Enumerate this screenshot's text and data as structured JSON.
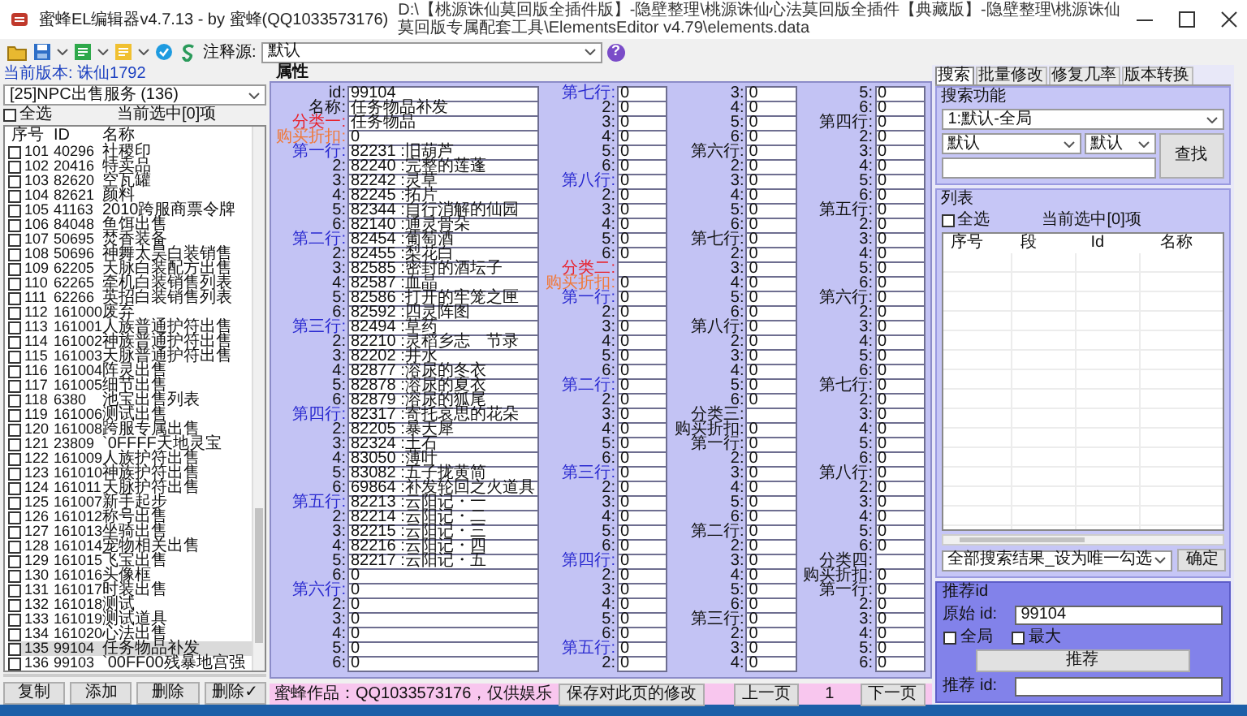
{
  "window": {
    "title": "蜜蜂EL编辑器v4.7.13 - by 蜜蜂(QQ1033573176)",
    "path": "D:\\【桃源诛仙莫回版全插件版】-隐壁整理\\桃源诛仙心法莫回版全插件【典藏版】-隐壁整理\\桃源诛仙莫回版专属配套工具\\ElementsEditor v4.79\\elements.data"
  },
  "toolbar": {
    "annotation_label": "注释源:",
    "annotation_source": "默认",
    "help": "?"
  },
  "left_panel": {
    "version": "当前版本: 诛仙1792",
    "category_select": "[25]NPC出售服务 (136)",
    "select_all": {
      "label": "全选",
      "checked": false
    },
    "selection_count": "当前选中[0]项",
    "columns": [
      "序号",
      "ID",
      "名称"
    ],
    "rows": [
      {
        "index": "101",
        "id": "40296",
        "name": "社稷印",
        "checked": false,
        "selected": false
      },
      {
        "index": "102",
        "id": "20416",
        "name": "特卖品",
        "checked": false,
        "selected": false
      },
      {
        "index": "103",
        "id": "82620",
        "name": "空瓦罐",
        "checked": false,
        "selected": false
      },
      {
        "index": "104",
        "id": "82621",
        "name": "颜料",
        "checked": false,
        "selected": false
      },
      {
        "index": "105",
        "id": "41163",
        "name": "2010跨服商票令牌",
        "checked": false,
        "selected": false
      },
      {
        "index": "106",
        "id": "84048",
        "name": "鱼饵出售",
        "checked": false,
        "selected": false
      },
      {
        "index": "107",
        "id": "50695",
        "name": "焚香装备",
        "checked": false,
        "selected": false
      },
      {
        "index": "108",
        "id": "50696",
        "name": "神舞太昊白装销售",
        "checked": false,
        "selected": false
      },
      {
        "index": "109",
        "id": "62205",
        "name": "天脉白装配方出售",
        "checked": false,
        "selected": false
      },
      {
        "index": "110",
        "id": "62265",
        "name": "牵机白装销售列表",
        "checked": false,
        "selected": false
      },
      {
        "index": "111",
        "id": "62266",
        "name": "英招白装销售列表",
        "checked": false,
        "selected": false
      },
      {
        "index": "112",
        "id": "161000",
        "name": "废弃",
        "checked": false,
        "selected": false
      },
      {
        "index": "113",
        "id": "161001",
        "name": "人族普通护符出售",
        "checked": false,
        "selected": false
      },
      {
        "index": "114",
        "id": "161002",
        "name": "神族普通护符出售",
        "checked": false,
        "selected": false
      },
      {
        "index": "115",
        "id": "161003",
        "name": "天脉普通护符出售",
        "checked": false,
        "selected": false
      },
      {
        "index": "116",
        "id": "161004",
        "name": "阵灵出售",
        "checked": false,
        "selected": false
      },
      {
        "index": "117",
        "id": "161005",
        "name": "细节出售",
        "checked": false,
        "selected": false
      },
      {
        "index": "118",
        "id": "6380",
        "name": "池宝出售列表",
        "checked": false,
        "selected": false
      },
      {
        "index": "119",
        "id": "161006",
        "name": "测试出售",
        "checked": false,
        "selected": false
      },
      {
        "index": "120",
        "id": "161008",
        "name": "跨服专属出售",
        "checked": false,
        "selected": false
      },
      {
        "index": "121",
        "id": "23809",
        "name": "`0FFFF天地灵宝",
        "checked": false,
        "selected": false
      },
      {
        "index": "122",
        "id": "161009",
        "name": "人族护符出售",
        "checked": false,
        "selected": false
      },
      {
        "index": "123",
        "id": "161010",
        "name": "神族护符出售",
        "checked": false,
        "selected": false
      },
      {
        "index": "124",
        "id": "161011",
        "name": "天脉护符出售",
        "checked": false,
        "selected": false
      },
      {
        "index": "125",
        "id": "161007",
        "name": "新手起步",
        "checked": false,
        "selected": false
      },
      {
        "index": "126",
        "id": "161012",
        "name": "称号出售",
        "checked": false,
        "selected": false
      },
      {
        "index": "127",
        "id": "161013",
        "name": "坐骑出售",
        "checked": false,
        "selected": false
      },
      {
        "index": "128",
        "id": "161014",
        "name": "宠物相关出售",
        "checked": false,
        "selected": false
      },
      {
        "index": "129",
        "id": "161015",
        "name": "飞宝出售",
        "checked": false,
        "selected": false
      },
      {
        "index": "130",
        "id": "161016",
        "name": "头像框",
        "checked": false,
        "selected": false
      },
      {
        "index": "131",
        "id": "161017",
        "name": "时装出售",
        "checked": false,
        "selected": false
      },
      {
        "index": "132",
        "id": "161018",
        "name": "测试",
        "checked": false,
        "selected": false
      },
      {
        "index": "133",
        "id": "161019",
        "name": "测试道具",
        "checked": false,
        "selected": false
      },
      {
        "index": "134",
        "id": "161020",
        "name": "心法出售",
        "checked": false,
        "selected": false
      },
      {
        "index": "135",
        "id": "99104",
        "name": "任务物品补发",
        "checked": false,
        "selected": true
      },
      {
        "index": "136",
        "id": "99103",
        "name": "`00FF00残暴地宫强",
        "checked": false,
        "selected": false
      }
    ],
    "buttons": [
      "复制",
      "添加",
      "删除",
      "删除✓"
    ]
  },
  "properties": {
    "title": "属性",
    "columns": [
      {
        "fields": [
          {
            "label": "id:",
            "value": "99104"
          },
          {
            "label": "名称:",
            "value": "任务物品补发"
          },
          {
            "label": "分类一:",
            "value": "任务物品",
            "color": "#e8202a"
          },
          {
            "label": "购买折扣:",
            "value": "0",
            "color": "#f07838"
          },
          {
            "label": "第一行:",
            "value": "82231 :旧葫芦",
            "color": "#2a2ad0"
          },
          {
            "label": "2:",
            "value": "82240 :完整的莲蓬"
          },
          {
            "label": "3:",
            "value": "82242 :灵草"
          },
          {
            "label": "4:",
            "value": "82245 :拓片"
          },
          {
            "label": "5:",
            "value": "82344 :自行消解的仙园"
          },
          {
            "label": "6:",
            "value": "82140 :通灵骨朵"
          },
          {
            "label": "第二行:",
            "value": "82454 :葡萄酒",
            "color": "#2a2ad0"
          },
          {
            "label": "2:",
            "value": "82455 :梨花白"
          },
          {
            "label": "3:",
            "value": "82585 :密封的酒坛子"
          },
          {
            "label": "4:",
            "value": "82587 :血晶"
          },
          {
            "label": "5:",
            "value": "82586 :打开的牢笼之匣"
          },
          {
            "label": "6:",
            "value": "82592 :四灵阵图"
          },
          {
            "label": "第三行:",
            "value": "82494 :草药",
            "color": "#2a2ad0"
          },
          {
            "label": "2:",
            "value": "82210 :灵稻乡志　节录"
          },
          {
            "label": "3:",
            "value": "82202 :井水"
          },
          {
            "label": "4:",
            "value": "82877 :溶尿的冬衣"
          },
          {
            "label": "5:",
            "value": "82878 :溶尿的夏衣"
          },
          {
            "label": "6:",
            "value": "82879 :溶尿的狐尾"
          },
          {
            "label": "第四行:",
            "value": "82317 :寄托哀思的花朵",
            "color": "#2a2ad0"
          },
          {
            "label": "2:",
            "value": "82205 :暴天犀"
          },
          {
            "label": "3:",
            "value": "82324 :土石"
          },
          {
            "label": "4:",
            "value": "83050 :薄叶"
          },
          {
            "label": "5:",
            "value": "83082 :五子拢黄简"
          },
          {
            "label": "6:",
            "value": "69864 :补发轮回之火道具"
          },
          {
            "label": "第五行:",
            "value": "82213 :云阳记・一",
            "color": "#2a2ad0"
          },
          {
            "label": "2:",
            "value": "82214 :云阳记・二"
          },
          {
            "label": "3:",
            "value": "82215 :云阳记・三"
          },
          {
            "label": "4:",
            "value": "82216 :云阳记・四"
          },
          {
            "label": "5:",
            "value": "82217 :云阳记・五"
          },
          {
            "label": "6:",
            "value": "0"
          },
          {
            "label": "第六行:",
            "value": "0",
            "color": "#2a2ad0"
          },
          {
            "label": "2:",
            "value": "0"
          },
          {
            "label": "3:",
            "value": "0"
          },
          {
            "label": "4:",
            "value": "0"
          },
          {
            "label": "5:",
            "value": "0"
          },
          {
            "label": "6:",
            "value": "0"
          }
        ]
      },
      {
        "fields": [
          {
            "label": "第七行:",
            "value": "0",
            "color": "#2a2ad0"
          },
          {
            "label": "2:",
            "value": "0"
          },
          {
            "label": "3:",
            "value": "0"
          },
          {
            "label": "4:",
            "value": "0"
          },
          {
            "label": "5:",
            "value": "0"
          },
          {
            "label": "6:",
            "value": "0"
          },
          {
            "label": "第八行:",
            "value": "0",
            "color": "#2a2ad0"
          },
          {
            "label": "2:",
            "value": "0"
          },
          {
            "label": "3:",
            "value": "0"
          },
          {
            "label": "4:",
            "value": "0"
          },
          {
            "label": "5:",
            "value": "0"
          },
          {
            "label": "6:",
            "value": "0"
          },
          {
            "label": "分类二:",
            "color": "#e8202a"
          },
          {
            "label": "购买折扣:",
            "value": "0",
            "color": "#f07838"
          },
          {
            "label": "第一行:",
            "value": "0",
            "color": "#2a2ad0"
          },
          {
            "label": "2:",
            "value": "0"
          },
          {
            "label": "3:",
            "value": "0"
          },
          {
            "label": "4:",
            "value": "0"
          },
          {
            "label": "5:",
            "value": "0"
          },
          {
            "label": "6:",
            "value": "0"
          },
          {
            "label": "第二行:",
            "value": "0",
            "color": "#2a2ad0"
          },
          {
            "label": "2:",
            "value": "0"
          },
          {
            "label": "3:",
            "value": "0"
          },
          {
            "label": "4:",
            "value": "0"
          },
          {
            "label": "5:",
            "value": "0"
          },
          {
            "label": "6:",
            "value": "0"
          },
          {
            "label": "第三行:",
            "value": "0",
            "color": "#2a2ad0"
          },
          {
            "label": "2:",
            "value": "0"
          },
          {
            "label": "3:",
            "value": "0"
          },
          {
            "label": "4:",
            "value": "0"
          },
          {
            "label": "5:",
            "value": "0"
          },
          {
            "label": "6:",
            "value": "0"
          },
          {
            "label": "第四行:",
            "value": "0",
            "color": "#2a2ad0"
          },
          {
            "label": "2:",
            "value": "0"
          },
          {
            "label": "3:",
            "value": "0"
          },
          {
            "label": "4:",
            "value": "0"
          },
          {
            "label": "5:",
            "value": "0"
          },
          {
            "label": "6:",
            "value": "0"
          },
          {
            "label": "第五行:",
            "value": "0",
            "color": "#2a2ad0"
          },
          {
            "label": "2:",
            "value": "0"
          }
        ]
      },
      {
        "fields": [
          {
            "label": "3:",
            "value": "0"
          },
          {
            "label": "4:",
            "value": "0"
          },
          {
            "label": "5:",
            "value": "0"
          },
          {
            "label": "6:",
            "value": "0"
          },
          {
            "label": "第六行:",
            "value": "0"
          },
          {
            "label": "2:",
            "value": "0"
          },
          {
            "label": "3:",
            "value": "0"
          },
          {
            "label": "4:",
            "value": "0"
          },
          {
            "label": "5:",
            "value": "0"
          },
          {
            "label": "6:",
            "value": "0"
          },
          {
            "label": "第七行:",
            "value": "0"
          },
          {
            "label": "2:",
            "value": "0"
          },
          {
            "label": "3:",
            "value": "0"
          },
          {
            "label": "4:",
            "value": "0"
          },
          {
            "label": "5:",
            "value": "0"
          },
          {
            "label": "6:",
            "value": "0"
          },
          {
            "label": "第八行:",
            "value": "0"
          },
          {
            "label": "2:",
            "value": "0"
          },
          {
            "label": "3:",
            "value": "0"
          },
          {
            "label": "4:",
            "value": "0"
          },
          {
            "label": "5:",
            "value": "0"
          },
          {
            "label": "6:",
            "value": "0"
          },
          {
            "label": "分类三:"
          },
          {
            "label": "购买折扣:",
            "value": "0"
          },
          {
            "label": "第一行:",
            "value": "0"
          },
          {
            "label": "2:",
            "value": "0"
          },
          {
            "label": "3:",
            "value": "0"
          },
          {
            "label": "4:",
            "value": "0"
          },
          {
            "label": "5:",
            "value": "0"
          },
          {
            "label": "6:",
            "value": "0"
          },
          {
            "label": "第二行:",
            "value": "0"
          },
          {
            "label": "2:",
            "value": "0"
          },
          {
            "label": "3:",
            "value": "0"
          },
          {
            "label": "4:",
            "value": "0"
          },
          {
            "label": "5:",
            "value": "0"
          },
          {
            "label": "6:",
            "value": "0"
          },
          {
            "label": "第三行:",
            "value": "0"
          },
          {
            "label": "2:",
            "value": "0"
          },
          {
            "label": "3:",
            "value": "0"
          },
          {
            "label": "4:",
            "value": "0"
          }
        ]
      },
      {
        "fields": [
          {
            "label": "5:",
            "value": "0"
          },
          {
            "label": "6:",
            "value": "0"
          },
          {
            "label": "第四行:",
            "value": "0"
          },
          {
            "label": "2:",
            "value": "0"
          },
          {
            "label": "3:",
            "value": "0"
          },
          {
            "label": "4:",
            "value": "0"
          },
          {
            "label": "5:",
            "value": "0"
          },
          {
            "label": "6:",
            "value": "0"
          },
          {
            "label": "第五行:",
            "value": "0"
          },
          {
            "label": "2:",
            "value": "0"
          },
          {
            "label": "3:",
            "value": "0"
          },
          {
            "label": "4:",
            "value": "0"
          },
          {
            "label": "5:",
            "value": "0"
          },
          {
            "label": "6:",
            "value": "0"
          },
          {
            "label": "第六行:",
            "value": "0"
          },
          {
            "label": "2:",
            "value": "0"
          },
          {
            "label": "3:",
            "value": "0"
          },
          {
            "label": "4:",
            "value": "0"
          },
          {
            "label": "5:",
            "value": "0"
          },
          {
            "label": "6:",
            "value": "0"
          },
          {
            "label": "第七行:",
            "value": "0"
          },
          {
            "label": "2:",
            "value": "0"
          },
          {
            "label": "3:",
            "value": "0"
          },
          {
            "label": "4:",
            "value": "0"
          },
          {
            "label": "5:",
            "value": "0"
          },
          {
            "label": "6:",
            "value": "0"
          },
          {
            "label": "第八行:",
            "value": "0"
          },
          {
            "label": "2:",
            "value": "0"
          },
          {
            "label": "3:",
            "value": "0"
          },
          {
            "label": "4:",
            "value": "0"
          },
          {
            "label": "5:",
            "value": "0"
          },
          {
            "label": "6:",
            "value": "0"
          },
          {
            "label": "分类四:"
          },
          {
            "label": "购买折扣:",
            "value": "0"
          },
          {
            "label": "第一行:",
            "value": "0"
          },
          {
            "label": "2:",
            "value": "0"
          },
          {
            "label": "3:",
            "value": "0"
          },
          {
            "label": "4:",
            "value": "0"
          },
          {
            "label": "5:",
            "value": "0"
          },
          {
            "label": "6:",
            "value": "0"
          }
        ]
      }
    ]
  },
  "status_bar": {
    "credit": "蜜蜂作品：QQ1033573176，仅供娱乐",
    "save_button": "保存对此页的修改",
    "prev_button": "上一页",
    "page": "1",
    "next_button": "下一页"
  },
  "right_panel": {
    "tabs": [
      {
        "label": "搜索",
        "selected": true
      },
      {
        "label": "批量修改",
        "selected": false
      },
      {
        "label": "修复几率",
        "selected": false
      },
      {
        "label": "版本转换",
        "selected": false
      }
    ],
    "search": {
      "title": "搜索功能",
      "scope_select": "1:默认-全局",
      "field_select": "默认",
      "mode_select": "默认",
      "find_button": "查找"
    },
    "list": {
      "title": "列表",
      "select_all": {
        "label": "全选",
        "checked": false
      },
      "selection_count": "当前选中[0]项",
      "columns": [
        "序号",
        "段",
        "Id",
        "名称"
      ]
    },
    "action_select": "全部搜索结果_设为唯一勾选",
    "confirm_button": "确定",
    "recommend": {
      "title": "推荐id",
      "original_label": "原始 id:",
      "original_value": "99104",
      "options": [
        {
          "label": "全局",
          "checked": false
        },
        {
          "label": "最大",
          "checked": false
        }
      ],
      "button": "推荐",
      "result_label": "推荐 id:"
    }
  }
}
